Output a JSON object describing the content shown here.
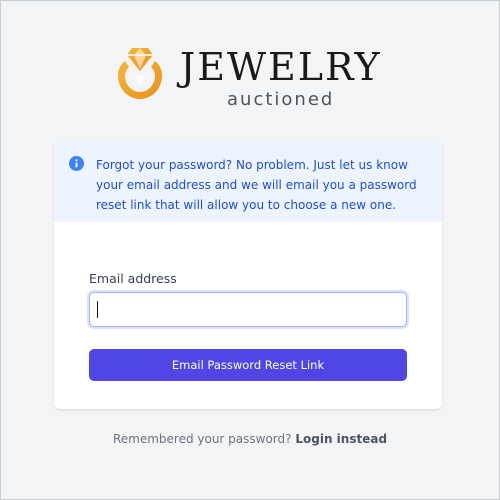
{
  "brand": {
    "name": "JEWELRY",
    "tagline": "auctioned",
    "logo_icon": "ring-diamond-icon",
    "accent_color": "#f4a62a"
  },
  "notice": {
    "icon": "info-icon",
    "text": "Forgot your password? No problem. Just let us know your email address and we will email you a password reset link that will allow you to choose a new one."
  },
  "form": {
    "email_label": "Email address",
    "email_value": "",
    "submit_label": "Email Password Reset Link",
    "button_color": "#4f46e5"
  },
  "footer": {
    "prompt": "Remembered your password?",
    "login_link": "Login instead"
  }
}
